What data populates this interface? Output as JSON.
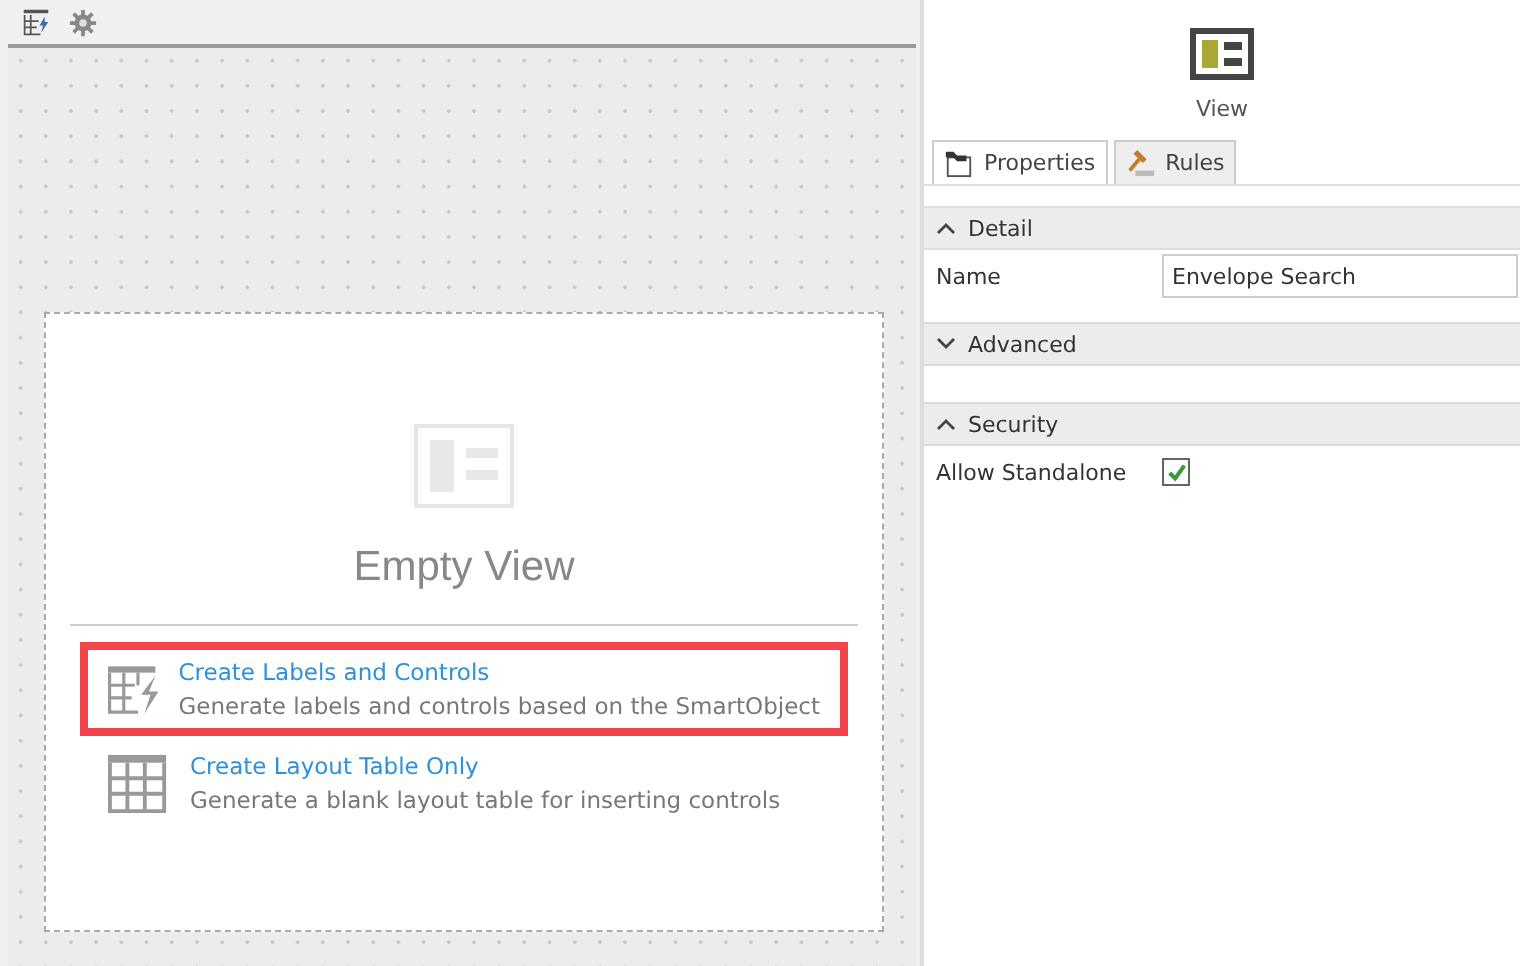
{
  "canvas": {
    "title": "Empty View",
    "options": [
      {
        "title": "Create Labels and Controls",
        "description": "Generate labels and controls based on the SmartObject",
        "highlighted": true,
        "kind": "lightning"
      },
      {
        "title": "Create Layout Table Only",
        "description": "Generate a blank layout table for inserting controls",
        "highlighted": false,
        "kind": "table"
      }
    ]
  },
  "panel": {
    "title": "View",
    "tabs": [
      {
        "label": "Properties",
        "selected": true,
        "kind": "properties"
      },
      {
        "label": "Rules",
        "selected": false,
        "kind": "rules"
      }
    ],
    "sections": [
      {
        "title": "Detail",
        "expanded": true,
        "rows": [
          {
            "kind": "text",
            "label": "Name",
            "value": "Envelope Search"
          }
        ]
      },
      {
        "title": "Advanced",
        "expanded": false
      },
      {
        "title": "Security",
        "expanded": true,
        "rows": [
          {
            "kind": "checkbox",
            "label": "Allow Standalone",
            "checked": true
          }
        ]
      }
    ]
  }
}
